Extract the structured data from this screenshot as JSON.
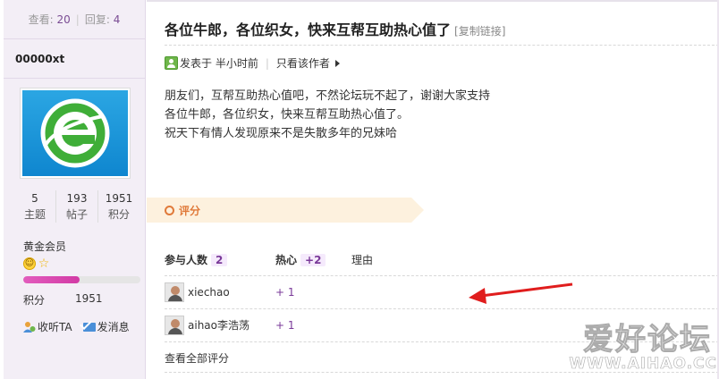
{
  "sidebar": {
    "views_label": "查看:",
    "views_value": "20",
    "replies_label": "回复:",
    "replies_value": "4",
    "username": "00000xt",
    "counts": [
      {
        "value": "5",
        "label": "主题"
      },
      {
        "value": "193",
        "label": "帖子"
      },
      {
        "value": "1951",
        "label": "积分"
      }
    ],
    "rank": "黄金会员",
    "progress_fraction": 0.48,
    "points_label": "积分",
    "points_value": "1951",
    "follow_label": "收听TA",
    "message_label": "发消息"
  },
  "post": {
    "title": "各位牛郎，各位织女，快来互帮互助热心值了",
    "copy_link": "[复制链接]",
    "posted_at": "发表于 半小时前",
    "author_only": "只看该作者",
    "body": [
      "朋友们，互帮互助热心值吧，不然论坛玩不起了，谢谢大家支持",
      "各位牛郎，各位织女，快来互帮互助热心值了。",
      "祝天下有情人发现原来不是失散多年的兄妹哈"
    ]
  },
  "rating": {
    "banner": "评分",
    "participants_label": "参与人数",
    "participants_count": "2",
    "hot_label": "热心",
    "hot_total": "+2",
    "reason_label": "理由",
    "rows": [
      {
        "user": "xiechao",
        "score": "+ 1"
      },
      {
        "user": "aihao李浩荡",
        "score": "+ 1"
      }
    ],
    "view_all": "查看全部评分"
  },
  "watermark": {
    "title": "爱好论坛",
    "url": "WWW.AIHAO.CC"
  },
  "colors": {
    "accent": "#7a3a99",
    "banner_bg": "#fdf1de",
    "banner_text": "#e07a3a",
    "arrow": "#e01d1d",
    "sidebar_bg": "#f3eef6"
  }
}
